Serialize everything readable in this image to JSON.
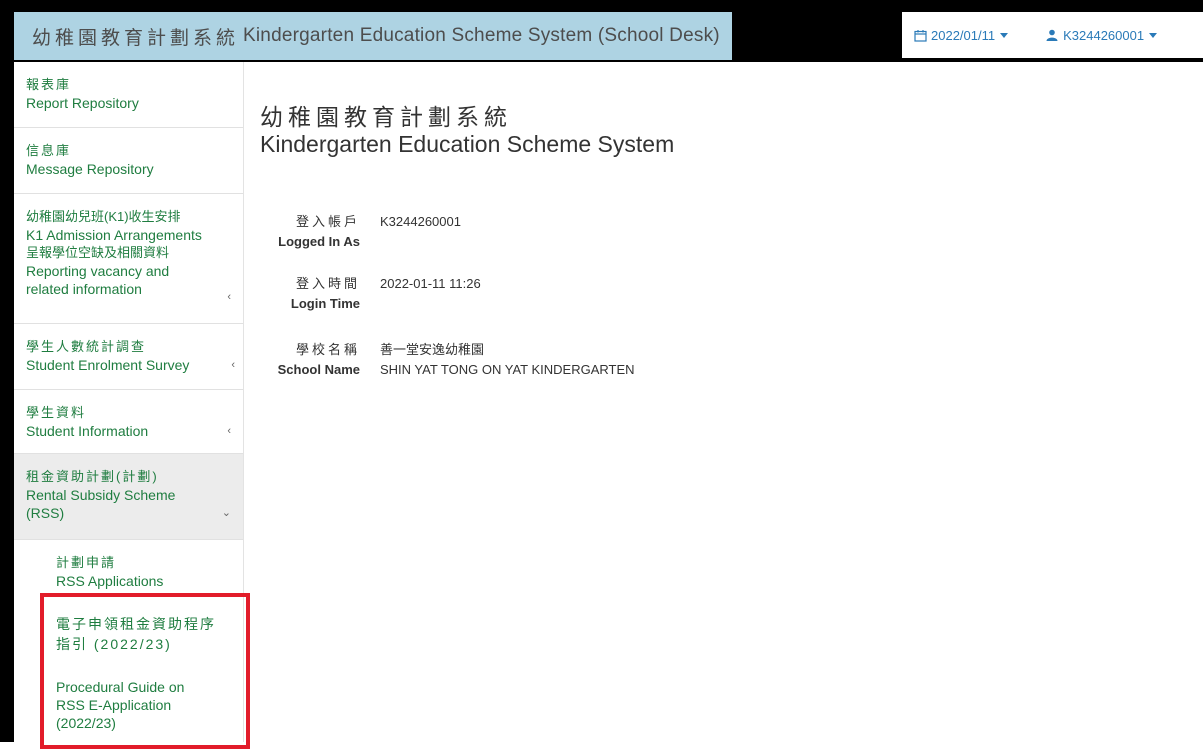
{
  "header": {
    "title_zh": "幼稚園教育計劃系統",
    "title_en": "Kindergarten Education Scheme System (School Desk)",
    "date": "2022/01/11",
    "user": "K3244260001"
  },
  "sidebar": {
    "items": [
      {
        "zh": "報表庫",
        "en": "Report Repository"
      },
      {
        "zh": "信息庫",
        "en": "Message Repository"
      },
      {
        "zh": "幼稚園幼兒班(K1)收生安排",
        "en": "K1 Admission Arrangements",
        "zh2": "呈報學位空缺及相關資料",
        "en2": "Reporting vacancy and related information"
      },
      {
        "zh": "學生人數統計調查",
        "en": "Student Enrolment Survey"
      },
      {
        "zh": "學生資料",
        "en": "Student Information"
      },
      {
        "zh": "租金資助計劃(計劃)",
        "en": "Rental Subsidy Scheme (RSS)"
      }
    ],
    "sub_items": [
      {
        "zh": "計劃申請",
        "en": "RSS Applications"
      },
      {
        "zh": "電子申領租金資助程序指引 (2022/23)",
        "en": "Procedural Guide on RSS E-Application (2022/23)"
      }
    ]
  },
  "main": {
    "title_zh": "幼稚園教育計劃系統",
    "title_en": "Kindergarten Education Scheme System",
    "info": [
      {
        "label_zh": "登入帳戶",
        "label_en": "Logged In As",
        "value": "K3244260001"
      },
      {
        "label_zh": "登入時間",
        "label_en": "Login Time",
        "value": "2022-01-11 11:26"
      },
      {
        "label_zh": "學校名稱",
        "label_en": "School Name",
        "value": "善一堂安逸幼稚園",
        "value2": "SHIN YAT TONG ON YAT KINDERGARTEN"
      }
    ]
  },
  "colors": {
    "link_green": "#1f7d40",
    "brand_bg": "#aed3e3",
    "topbar_link": "#2a7ab8",
    "highlight": "#e21c2a"
  },
  "icons": {
    "date": "calendar-icon",
    "user": "user-icon",
    "collapsed": "chevron-left-icon",
    "expanded": "chevron-down-icon"
  }
}
